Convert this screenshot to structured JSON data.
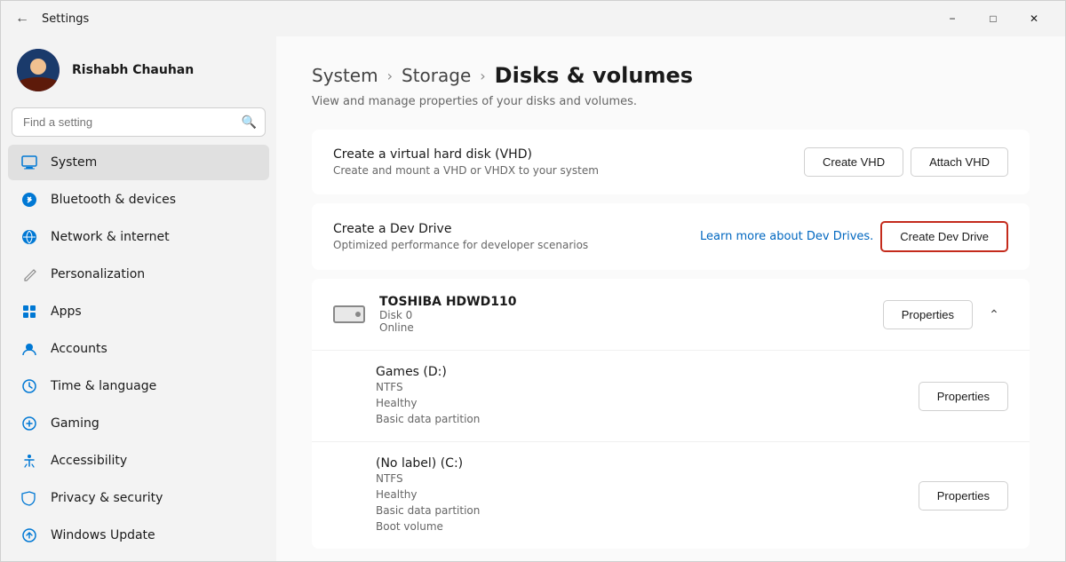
{
  "titlebar": {
    "title": "Settings",
    "minimize_label": "−",
    "maximize_label": "□",
    "close_label": "✕"
  },
  "sidebar": {
    "user": {
      "name": "Rishabh Chauhan"
    },
    "search": {
      "placeholder": "Find a setting"
    },
    "nav": [
      {
        "id": "system",
        "label": "System",
        "active": true
      },
      {
        "id": "bluetooth",
        "label": "Bluetooth & devices",
        "active": false
      },
      {
        "id": "network",
        "label": "Network & internet",
        "active": false
      },
      {
        "id": "personalization",
        "label": "Personalization",
        "active": false
      },
      {
        "id": "apps",
        "label": "Apps",
        "active": false
      },
      {
        "id": "accounts",
        "label": "Accounts",
        "active": false
      },
      {
        "id": "time",
        "label": "Time & language",
        "active": false
      },
      {
        "id": "gaming",
        "label": "Gaming",
        "active": false
      },
      {
        "id": "accessibility",
        "label": "Accessibility",
        "active": false
      },
      {
        "id": "privacy",
        "label": "Privacy & security",
        "active": false
      },
      {
        "id": "windowsupdate",
        "label": "Windows Update",
        "active": false
      }
    ]
  },
  "header": {
    "breadcrumb1": "System",
    "breadcrumb2": "Storage",
    "title": "Disks & volumes",
    "subtitle": "View and manage properties of your disks and volumes."
  },
  "vhd_card": {
    "title": "Create a virtual hard disk (VHD)",
    "desc": "Create and mount a VHD or VHDX to your system",
    "btn1": "Create VHD",
    "btn2": "Attach VHD"
  },
  "devdrive_card": {
    "title": "Create a Dev Drive",
    "desc": "Optimized performance for developer scenarios",
    "link": "Learn more about Dev Drives.",
    "btn": "Create Dev Drive"
  },
  "disk": {
    "name": "TOSHIBA HDWD110",
    "disk_label": "Disk 0",
    "status": "Online",
    "btn": "Properties",
    "volumes": [
      {
        "name": "Games (D:)",
        "fs": "NTFS",
        "health": "Healthy",
        "type": "Basic data partition",
        "boot": "",
        "btn": "Properties"
      },
      {
        "name": "(No label) (C:)",
        "fs": "NTFS",
        "health": "Healthy",
        "type": "Basic data partition",
        "boot": "Boot volume",
        "btn": "Properties"
      }
    ]
  }
}
